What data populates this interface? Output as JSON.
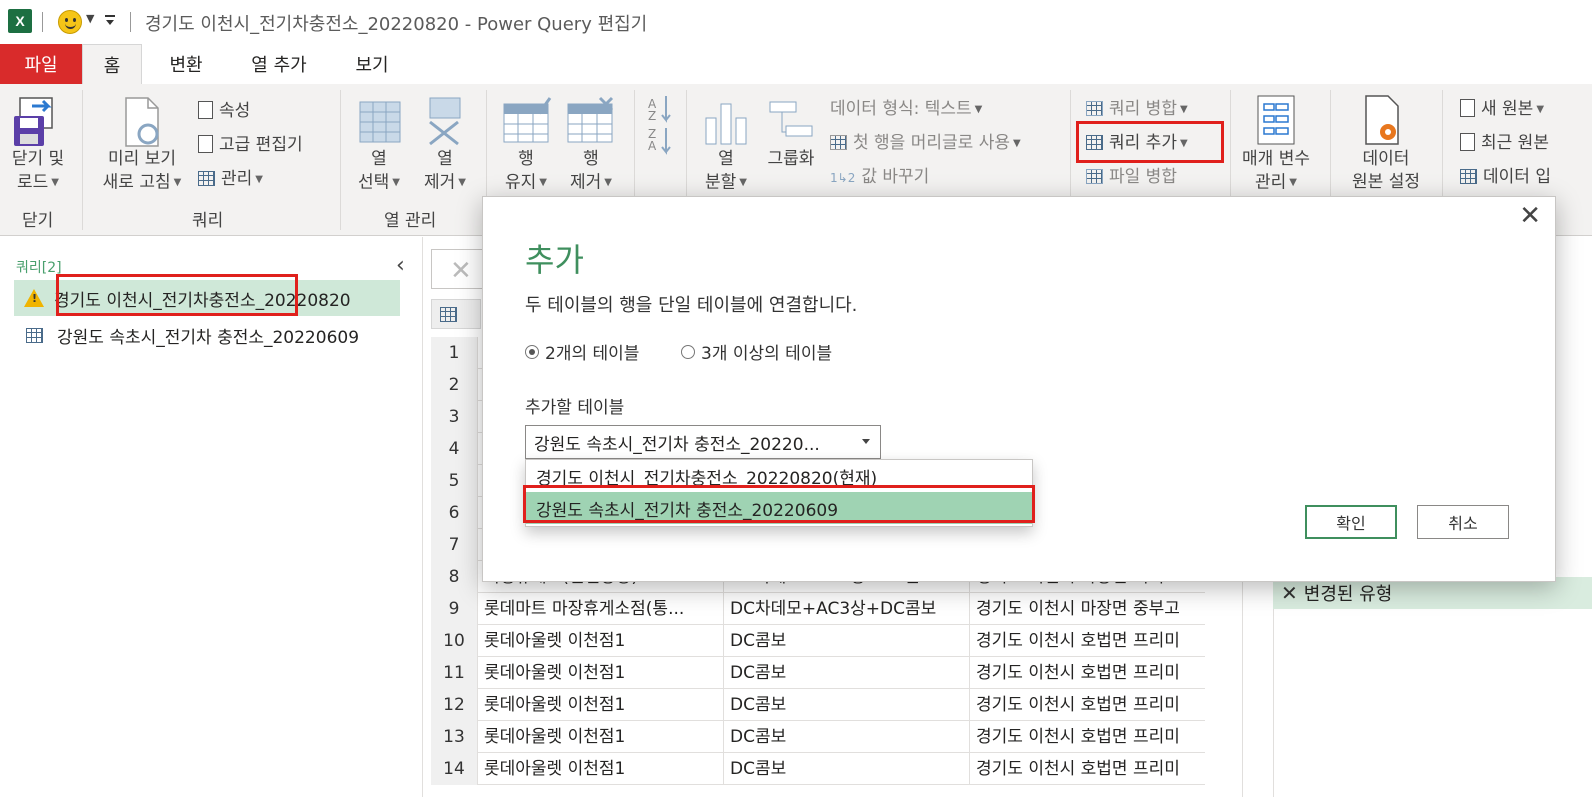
{
  "window": {
    "title": "경기도 이천시_전기차충전소_20220820 - Power Query 편집기",
    "app_icon": "X"
  },
  "tabs": [
    "파일",
    "홈",
    "변환",
    "열 추가",
    "보기"
  ],
  "ribbon": {
    "close_load": {
      "line1": "닫기 및",
      "line2": "로드"
    },
    "refresh_preview": {
      "line1": "미리 보기",
      "line2": "새로 고침"
    },
    "properties": "속성",
    "advanced_editor": "고급 편집기",
    "manage": "관리",
    "choose_columns": {
      "line1": "열",
      "line2": "선택"
    },
    "remove_columns": {
      "line1": "열",
      "line2": "제거"
    },
    "keep_rows": {
      "line1": "행",
      "line2": "유지"
    },
    "remove_rows": {
      "line1": "행",
      "line2": "제거"
    },
    "split_column": {
      "line1": "열",
      "line2": "분할"
    },
    "group_by": "그룹화",
    "data_type": "데이터 형식: 텍스트",
    "use_first_row": "첫 행을 머리글로 사용",
    "replace_values": "값 바꾸기",
    "merge_queries": "쿼리 병합",
    "append_queries": "쿼리 추가",
    "combine_files": "파일 병합",
    "manage_parameters": {
      "line1": "매개 변수",
      "line2": "관리"
    },
    "data_source_settings": {
      "line1": "데이터",
      "line2": "원본 설정"
    },
    "new_source": "새 원본",
    "recent_sources": "최근 원본",
    "enter_data": "데이터 입",
    "groups": {
      "close": "닫기",
      "query": "쿼리",
      "manage_columns": "열 관리"
    }
  },
  "query_pane": {
    "header": "쿼리[2]",
    "items": [
      {
        "label": "경기도 이천시_전기차충전소_20220820",
        "icon": "warning-icon",
        "selected": true
      },
      {
        "label": "강원도 속초시_전기차 충전소_20220609",
        "icon": "table-icon",
        "selected": false
      }
    ]
  },
  "grid": {
    "rows": [
      {
        "n": "1",
        "c1": "",
        "c2": "",
        "c3": ""
      },
      {
        "n": "2",
        "c1": "",
        "c2": "",
        "c3": ""
      },
      {
        "n": "3",
        "c1": "",
        "c2": "",
        "c3": ""
      },
      {
        "n": "4",
        "c1": "",
        "c2": "",
        "c3": ""
      },
      {
        "n": "5",
        "c1": "",
        "c2": "",
        "c3": ""
      },
      {
        "n": "6",
        "c1": "",
        "c2": "",
        "c3": ""
      },
      {
        "n": "7",
        "c1": "",
        "c2": "",
        "c3": ""
      },
      {
        "n": "8",
        "c1": "덕평휴게소(인천방향)",
        "c2": "DC차데모+AC3상+DC콤보",
        "c3": "경기도 이천시 마장면 덕이로"
      },
      {
        "n": "9",
        "c1": "롯데마트 마장휴게소점(통...",
        "c2": "DC차데모+AC3상+DC콤보",
        "c3": "경기도 이천시 마장면 중부고"
      },
      {
        "n": "10",
        "c1": "롯데아울렛 이천점1",
        "c2": "DC콤보",
        "c3": "경기도 이천시 호법면 프리미"
      },
      {
        "n": "11",
        "c1": "롯데아울렛 이천점1",
        "c2": "DC콤보",
        "c3": "경기도 이천시 호법면 프리미"
      },
      {
        "n": "12",
        "c1": "롯데아울렛 이천점1",
        "c2": "DC콤보",
        "c3": "경기도 이천시 호법면 프리미"
      },
      {
        "n": "13",
        "c1": "롯데아울렛 이천점1",
        "c2": "DC콤보",
        "c3": "경기도 이천시 호법면 프리미"
      },
      {
        "n": "14",
        "c1": "롯데아울렛 이천점1",
        "c2": "DC콤보",
        "c3": "경기도 이천시 호법면 프리미"
      }
    ]
  },
  "applied_steps": {
    "last_step": "변경된 유형"
  },
  "dialog": {
    "title": "추가",
    "description": "두 테이블의 행을 단일 테이블에 연결합니다.",
    "radio_two": "2개의 테이블",
    "radio_three": "3개 이상의 테이블",
    "table_label": "추가할 테이블",
    "selected_value": "강원도 속초시_전기차 충전소_20220...",
    "options": [
      "경기도 이천시_전기차충전소_20220820(현재)",
      "강원도 속초시_전기차 충전소_20220609"
    ],
    "ok": "확인",
    "cancel": "취소"
  },
  "colors": {
    "accent_green": "#3f8f5e",
    "file_tab_red": "#d92b2b",
    "highlight_red": "#e0201c",
    "selection_green": "#9fd3b3"
  }
}
